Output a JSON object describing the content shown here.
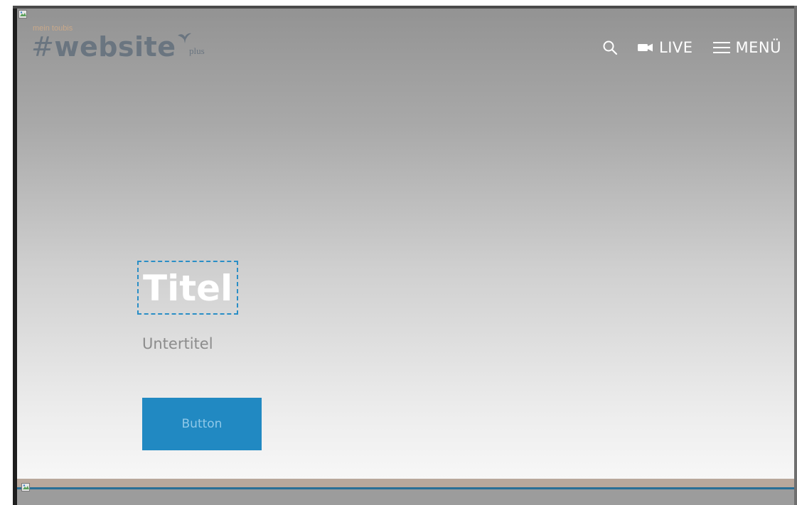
{
  "header": {
    "logo": {
      "tagline": "mein toubis",
      "hash": "#",
      "word": "website",
      "plus": "plus"
    },
    "nav": {
      "search_icon": "search-icon",
      "live_label": "LIVE",
      "live_icon": "video-camera-icon",
      "menu_label": "MENÜ",
      "menu_icon": "hamburger-icon"
    }
  },
  "hero": {
    "title": "Titel",
    "subtitle": "Untertitel",
    "button_label": "Button"
  },
  "colors": {
    "accent": "#2189c2",
    "button_text": "#8fc8e8",
    "logo": "#6a7580",
    "tagline": "#c9a889",
    "selection_outline": "#2a8ec6"
  }
}
